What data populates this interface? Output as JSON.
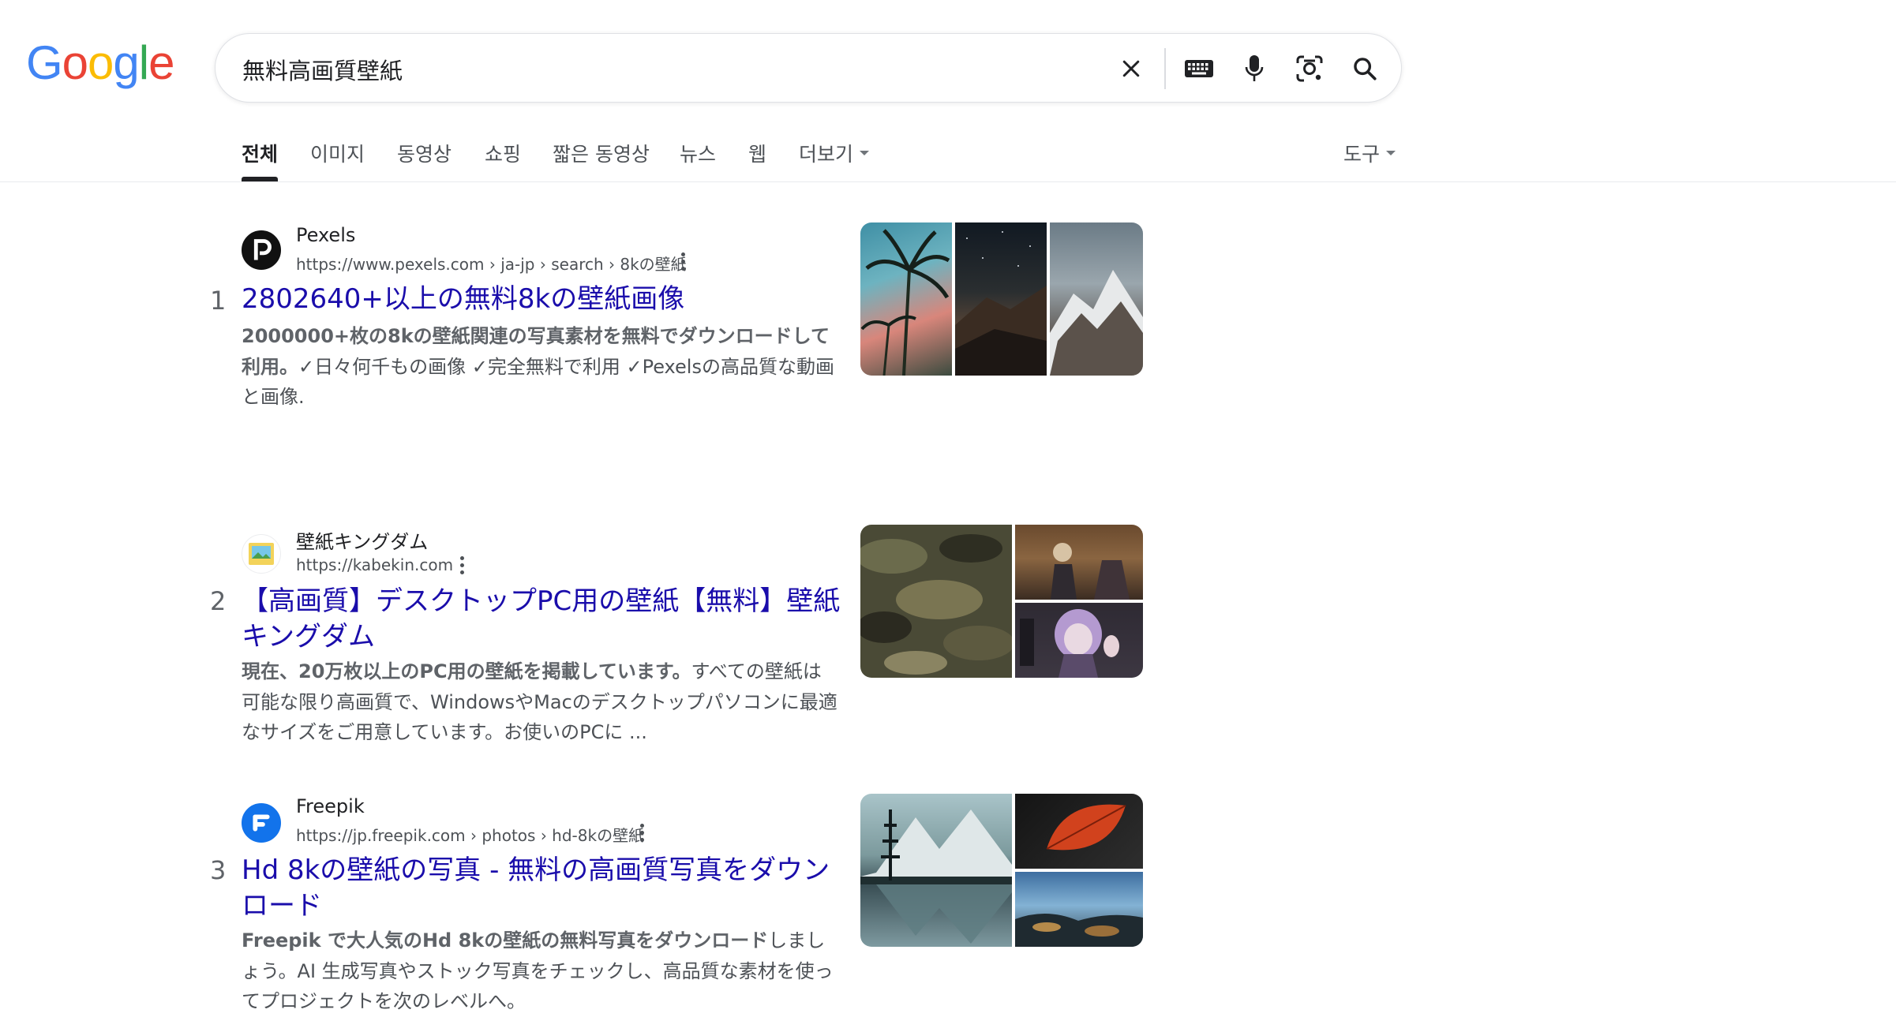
{
  "logo": {
    "letters": [
      "G",
      "o",
      "o",
      "g",
      "l",
      "e"
    ],
    "colors": [
      "#4285F4",
      "#EA4335",
      "#FBBC05",
      "#4285F4",
      "#34A853",
      "#EA4335"
    ]
  },
  "search": {
    "query": "無料高画質壁紙"
  },
  "icons": {
    "clear": "close-icon",
    "keyboard": "keyboard-icon",
    "voice": "mic-icon",
    "lens": "google-lens-icon",
    "search": "search-icon"
  },
  "tabs": [
    {
      "label": "전체",
      "active": true
    },
    {
      "label": "이미지"
    },
    {
      "label": "동영상"
    },
    {
      "label": "쇼핑"
    },
    {
      "label": "짧은 동영상"
    },
    {
      "label": "뉴스"
    },
    {
      "label": "웹"
    },
    {
      "label": "더보기"
    }
  ],
  "tools_label": "도구",
  "results": [
    {
      "rank": "1",
      "site": "Pexels",
      "url": "https://www.pexels.com › ja-jp › search › 8kの壁紙",
      "title": "2802640+以上の無料8kの壁紙画像",
      "snippet_bold": "2000000+枚の8kの壁紙関連の写真素材を無料でダウンロードして利用。",
      "snippet_rest": "✓日々何千もの画像 ✓完全無料で利用 ✓Pexelsの高品質な動画と画像.",
      "favicon": "pexels-logo-icon"
    },
    {
      "rank": "2",
      "site": "壁紙キングダム",
      "url": "https://kabekin.com",
      "title": "【高画質】デスクトップPC用の壁紙【無料】壁紙キングダム",
      "snippet_bold": "現在、20万枚以上のPC用の壁紙を掲載しています。",
      "snippet_rest": "すべての壁紙は可能な限り高画質で、WindowsやMacのデスクトップパソコンに最適なサイズをご用意しています。お使いのPCに ...",
      "favicon": "kabekin-logo-icon"
    },
    {
      "rank": "3",
      "site": "Freepik",
      "url": "https://jp.freepik.com › photos › hd-8kの壁紙",
      "title": "Hd 8kの壁紙の写真 - 無料の高画質写真をダウンロード",
      "snippet_bold": "Freepik で大人気のHd 8kの壁紙の無料写真をダウンロード",
      "snippet_rest": "しましょう。AI 生成写真やストック写真をチェックし、高品質な素材を使ってプロジェクトを次のレベルへ。",
      "favicon": "freepik-logo-icon"
    }
  ]
}
